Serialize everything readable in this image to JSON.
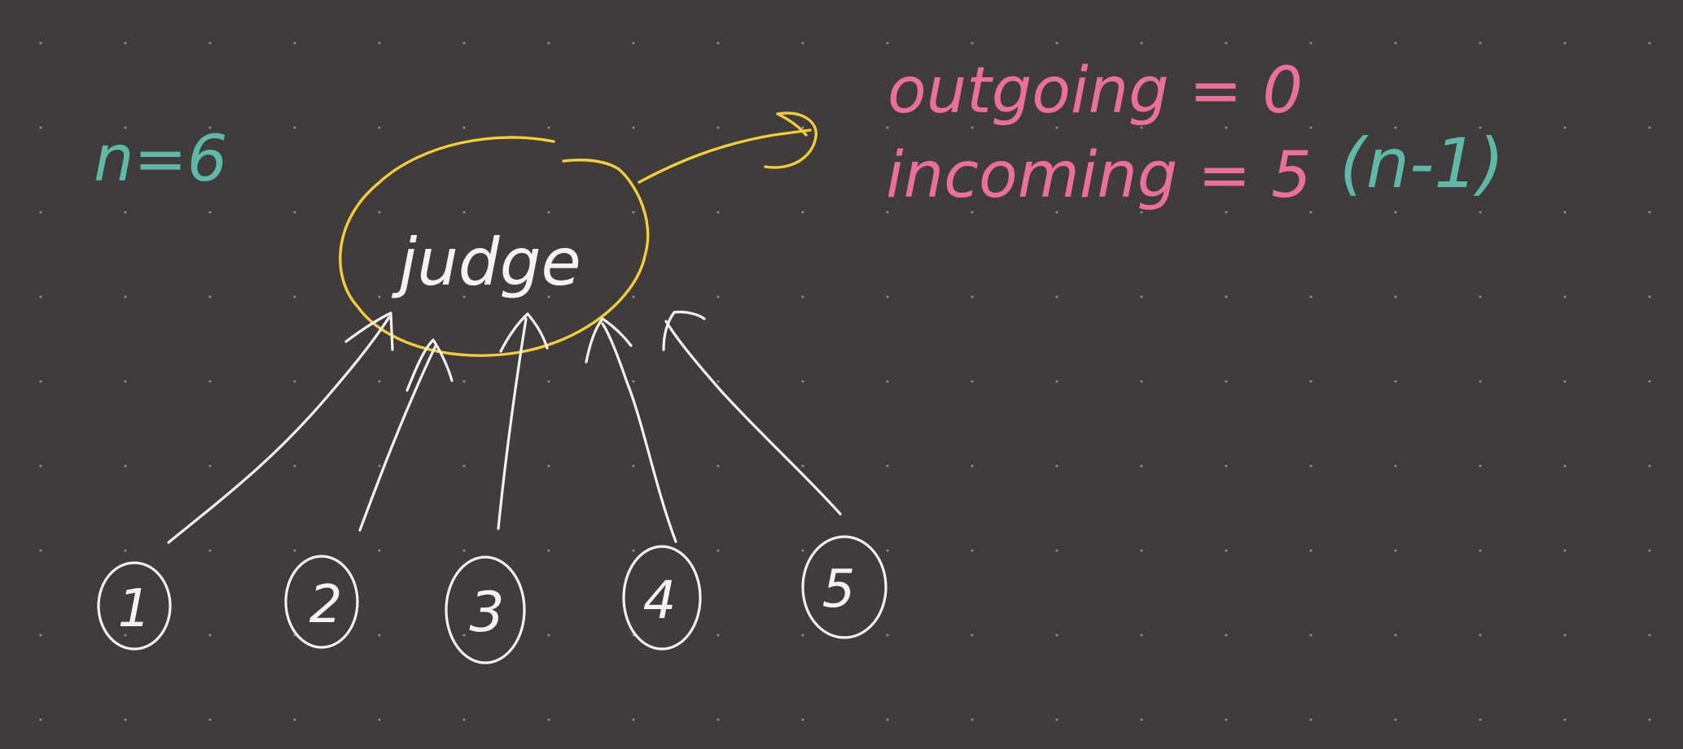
{
  "board": {
    "background_color": "#403c3b",
    "grid": "dotted"
  },
  "colors": {
    "teal": "#5fb8a8",
    "pink": "#ea6f9c",
    "yellow": "#f3cd3c",
    "white": "#f4f2f0"
  },
  "labels": {
    "n_equals": "n=6",
    "judge": "judge",
    "outgoing": "outgoing = 0",
    "incoming": "incoming = 5",
    "n_minus_1": "(n-1)"
  },
  "nodes": [
    "1",
    "2",
    "3",
    "4",
    "5"
  ]
}
